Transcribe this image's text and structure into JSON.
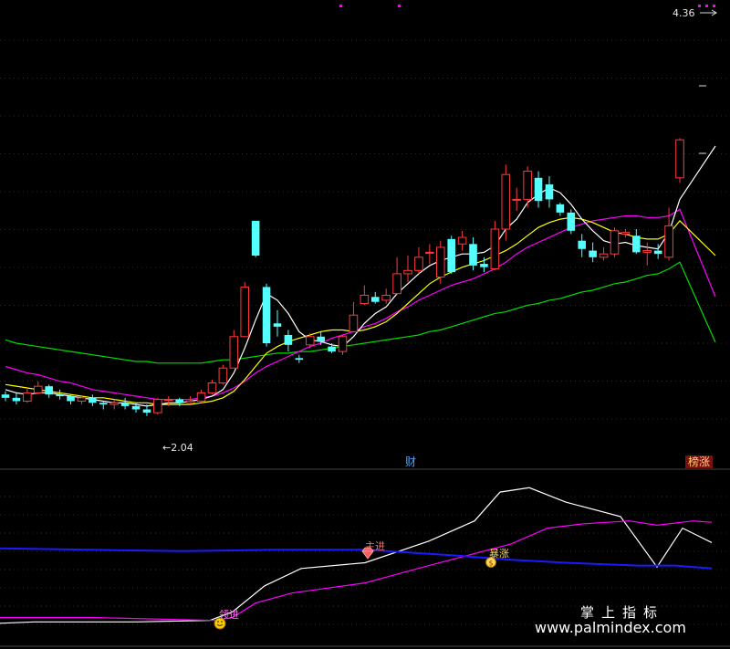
{
  "labels": {
    "price_high": "4.36",
    "price_low": "←2.04",
    "cai_badge": "财",
    "bang_badge": "榜涨",
    "signal_lingjin": "领进",
    "signal_zhujin": "主进",
    "signal_jizhang": "暴涨",
    "watermark_cn": "掌上指标",
    "watermark_url": "www.palmindex.com"
  },
  "colors": {
    "background": "#000000",
    "grid": "#2a2a2a",
    "up_candle": "#ff3a3a",
    "down_candle": "#54ffff",
    "ma_white": "#ffffff",
    "ma_yellow": "#ffff00",
    "ma_magenta": "#ff00ff",
    "ma_green": "#00dd00",
    "ind_blue": "#1a1aff",
    "ind_white": "#ffffff",
    "ind_magenta": "#ff00ff"
  },
  "icons": {
    "lingjin_marker": "smiley-face-icon",
    "zhujin_marker": "red-diamond-icon",
    "jizhang_marker": "money-bag-icon"
  },
  "chart_data": [
    {
      "type": "candlestick",
      "ylim": [
        1.84,
        4.5
      ],
      "y_high": 4.36,
      "y_low": 2.04,
      "candles": [
        [
          2.17,
          2.15,
          2.19,
          2.13
        ],
        [
          2.15,
          2.13,
          2.18,
          2.11
        ],
        [
          2.13,
          2.18,
          2.21,
          2.12
        ],
        [
          2.18,
          2.22,
          2.25,
          2.17
        ],
        [
          2.22,
          2.17,
          2.23,
          2.15
        ],
        [
          2.17,
          2.16,
          2.2,
          2.14
        ],
        [
          2.16,
          2.13,
          2.17,
          2.11
        ],
        [
          2.13,
          2.15,
          2.16,
          2.11
        ],
        [
          2.15,
          2.12,
          2.17,
          2.1
        ],
        [
          2.12,
          2.11,
          2.13,
          2.08
        ],
        [
          2.11,
          2.12,
          2.14,
          2.08
        ],
        [
          2.12,
          2.1,
          2.15,
          2.08
        ],
        [
          2.1,
          2.08,
          2.12,
          2.06
        ],
        [
          2.08,
          2.06,
          2.11,
          2.04
        ],
        [
          2.06,
          2.14,
          2.15,
          2.05
        ],
        [
          2.14,
          2.14,
          2.16,
          2.1
        ],
        [
          2.14,
          2.12,
          2.15,
          2.1
        ],
        [
          2.12,
          2.13,
          2.16,
          2.11
        ],
        [
          2.13,
          2.18,
          2.2,
          2.12
        ],
        [
          2.18,
          2.24,
          2.26,
          2.17
        ],
        [
          2.24,
          2.33,
          2.35,
          2.23
        ],
        [
          2.33,
          2.52,
          2.56,
          2.33
        ],
        [
          2.52,
          2.82,
          2.85,
          2.55
        ],
        [
          3.22,
          3.01,
          3.22,
          3.0
        ],
        [
          2.82,
          2.48,
          2.84,
          2.46
        ],
        [
          2.6,
          2.58,
          2.68,
          2.52
        ],
        [
          2.53,
          2.47,
          2.56,
          2.43
        ],
        [
          2.39,
          2.38,
          2.41,
          2.36
        ],
        [
          2.47,
          2.52,
          2.54,
          2.45
        ],
        [
          2.52,
          2.49,
          2.55,
          2.47
        ],
        [
          2.46,
          2.43,
          2.48,
          2.42
        ],
        [
          2.43,
          2.52,
          2.53,
          2.41
        ],
        [
          2.55,
          2.65,
          2.73,
          2.55
        ],
        [
          2.72,
          2.77,
          2.83,
          2.71
        ],
        [
          2.76,
          2.73,
          2.79,
          2.72
        ],
        [
          2.74,
          2.77,
          2.81,
          2.72
        ],
        [
          2.78,
          2.9,
          3.0,
          2.77
        ],
        [
          2.9,
          2.92,
          3.01,
          2.85
        ],
        [
          2.92,
          3.0,
          3.06,
          2.9
        ],
        [
          3.03,
          3.03,
          3.08,
          2.96
        ],
        [
          2.88,
          3.06,
          3.1,
          2.84
        ],
        [
          3.11,
          2.91,
          3.13,
          2.9
        ],
        [
          3.08,
          3.12,
          3.16,
          3.04
        ],
        [
          3.08,
          2.95,
          3.12,
          2.92
        ],
        [
          2.96,
          2.94,
          3.0,
          2.91
        ],
        [
          2.93,
          3.17,
          3.22,
          2.92
        ],
        [
          3.17,
          3.5,
          3.56,
          3.1
        ],
        [
          3.35,
          3.35,
          3.42,
          3.28
        ],
        [
          3.35,
          3.52,
          3.55,
          3.3
        ],
        [
          3.48,
          3.34,
          3.52,
          3.3
        ],
        [
          3.44,
          3.35,
          3.49,
          3.3
        ],
        [
          3.32,
          3.27,
          3.33,
          3.25
        ],
        [
          3.27,
          3.16,
          3.29,
          3.14
        ],
        [
          3.1,
          3.05,
          3.14,
          3.0
        ],
        [
          3.04,
          3.0,
          3.09,
          2.97
        ],
        [
          3.0,
          3.02,
          3.06,
          2.98
        ],
        [
          3.02,
          3.16,
          3.18,
          3.0
        ],
        [
          3.14,
          3.15,
          3.17,
          3.12
        ],
        [
          3.13,
          3.03,
          3.17,
          3.02
        ],
        [
          3.03,
          3.04,
          3.09,
          2.95
        ],
        [
          3.04,
          3.02,
          3.08,
          2.99
        ],
        [
          3.0,
          3.19,
          3.3,
          2.98
        ],
        [
          3.48,
          3.71,
          3.72,
          3.45
        ]
      ],
      "ma_white": [
        2.2,
        2.18,
        2.17,
        2.18,
        2.18,
        2.17,
        2.16,
        2.15,
        2.14,
        2.13,
        2.12,
        2.12,
        2.11,
        2.1,
        2.11,
        2.12,
        2.12,
        2.13,
        2.14,
        2.16,
        2.2,
        2.3,
        2.45,
        2.62,
        2.78,
        2.74,
        2.66,
        2.55,
        2.5,
        2.49,
        2.47,
        2.46,
        2.52,
        2.6,
        2.66,
        2.7,
        2.78,
        2.84,
        2.9,
        2.95,
        2.98,
        3.0,
        3.02,
        3.02,
        3.03,
        3.07,
        3.17,
        3.23,
        3.33,
        3.38,
        3.42,
        3.39,
        3.32,
        3.23,
        3.16,
        3.1,
        3.08,
        3.09,
        3.07,
        3.06,
        3.05,
        3.15,
        3.35
      ],
      "ma_yellow": [
        2.23,
        2.22,
        2.21,
        2.2,
        2.19,
        2.18,
        2.17,
        2.16,
        2.15,
        2.15,
        2.14,
        2.13,
        2.12,
        2.12,
        2.11,
        2.11,
        2.11,
        2.11,
        2.12,
        2.13,
        2.15,
        2.19,
        2.26,
        2.34,
        2.42,
        2.46,
        2.49,
        2.51,
        2.53,
        2.55,
        2.56,
        2.56,
        2.55,
        2.56,
        2.58,
        2.61,
        2.66,
        2.72,
        2.78,
        2.84,
        2.88,
        2.91,
        2.94,
        2.96,
        2.98,
        3.01,
        3.04,
        3.08,
        3.13,
        3.18,
        3.21,
        3.23,
        3.24,
        3.23,
        3.21,
        3.18,
        3.15,
        3.14,
        3.12,
        3.11,
        3.11,
        3.14,
        3.22
      ],
      "ma_magenta": [
        2.34,
        2.32,
        2.3,
        2.29,
        2.27,
        2.25,
        2.24,
        2.22,
        2.2,
        2.19,
        2.18,
        2.17,
        2.16,
        2.15,
        2.14,
        2.14,
        2.14,
        2.14,
        2.15,
        2.16,
        2.18,
        2.21,
        2.25,
        2.3,
        2.34,
        2.37,
        2.4,
        2.43,
        2.46,
        2.48,
        2.51,
        2.53,
        2.55,
        2.58,
        2.6,
        2.63,
        2.67,
        2.7,
        2.74,
        2.77,
        2.8,
        2.83,
        2.85,
        2.87,
        2.9,
        2.93,
        2.97,
        3.02,
        3.06,
        3.09,
        3.12,
        3.15,
        3.18,
        3.2,
        3.22,
        3.23,
        3.24,
        3.25,
        3.25,
        3.24,
        3.24,
        3.25,
        3.29
      ],
      "ma_green": [
        2.5,
        2.48,
        2.47,
        2.46,
        2.45,
        2.44,
        2.43,
        2.42,
        2.41,
        2.4,
        2.39,
        2.38,
        2.37,
        2.37,
        2.36,
        2.36,
        2.36,
        2.36,
        2.36,
        2.37,
        2.38,
        2.38,
        2.39,
        2.4,
        2.41,
        2.42,
        2.42,
        2.43,
        2.43,
        2.44,
        2.45,
        2.46,
        2.47,
        2.48,
        2.49,
        2.5,
        2.51,
        2.52,
        2.53,
        2.55,
        2.56,
        2.58,
        2.6,
        2.62,
        2.64,
        2.66,
        2.67,
        2.69,
        2.71,
        2.72,
        2.74,
        2.75,
        2.77,
        2.79,
        2.8,
        2.82,
        2.84,
        2.85,
        2.87,
        2.89,
        2.9,
        2.93,
        2.97
      ]
    },
    {
      "type": "line",
      "series": [
        {
          "x": [
            0,
            38,
            150,
            230,
            255,
            290,
            330,
            400,
            470,
            520,
            548,
            580,
            620,
            680,
            720,
            748,
            780
          ],
          "values": [
            2,
            3,
            3,
            4,
            10,
            28,
            40,
            44,
            59,
            73,
            93,
            96,
            86,
            76,
            41,
            68,
            58
          ]
        },
        {
          "x": [
            0,
            100,
            235,
            255,
            280,
            320,
            400,
            470,
            530,
            560,
            600,
            640,
            690,
            720,
            760,
            780
          ],
          "values": [
            6,
            6,
            4,
            6,
            16,
            23,
            30,
            42,
            52,
            57,
            68,
            71,
            73,
            70,
            73,
            72
          ]
        },
        {
          "x": [
            0,
            100,
            200,
            300,
            400,
            500,
            560,
            620,
            700,
            740,
            780
          ],
          "values": [
            54,
            53,
            52,
            53,
            53,
            49,
            46,
            44,
            42,
            42,
            40
          ]
        }
      ]
    }
  ]
}
